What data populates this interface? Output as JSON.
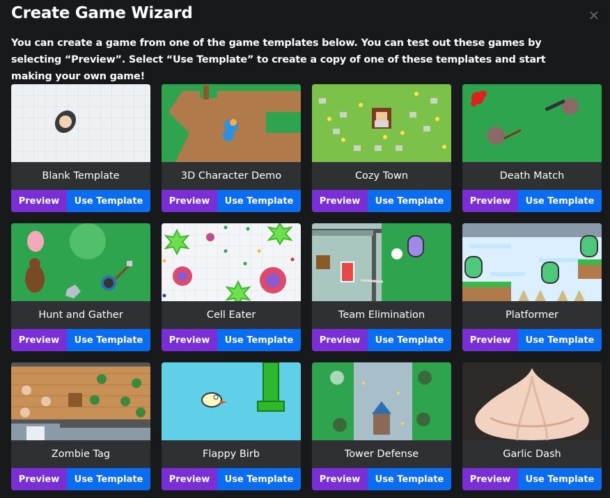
{
  "dialog": {
    "title": "Create Game Wizard",
    "description": "You can create a game from one of the game templates below. You can test out these games by selecting “Preview”. Select “Use Template” to create a copy of one of these templates and start making your own game!",
    "close_icon": "close-icon"
  },
  "buttons": {
    "preview_label": "Preview",
    "use_label": "Use Template"
  },
  "colors": {
    "preview": "#7a2ed6",
    "use": "#0a6cf0",
    "card": "#2e3034",
    "background": "#18191b"
  },
  "templates": [
    {
      "name": "Blank Template"
    },
    {
      "name": "3D Character Demo"
    },
    {
      "name": "Cozy Town"
    },
    {
      "name": "Death Match"
    },
    {
      "name": "Hunt and Gather"
    },
    {
      "name": "Cell Eater"
    },
    {
      "name": "Team Elimination"
    },
    {
      "name": "Platformer"
    },
    {
      "name": "Zombie Tag"
    },
    {
      "name": "Flappy Birb"
    },
    {
      "name": "Tower Defense"
    },
    {
      "name": "Garlic Dash"
    }
  ]
}
